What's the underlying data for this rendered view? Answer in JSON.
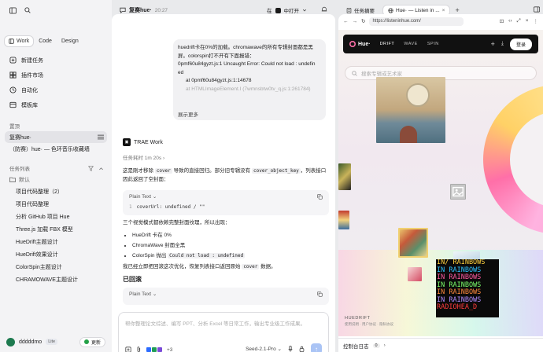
{
  "sidebar": {
    "segments": [
      {
        "label": "Work",
        "active": true
      },
      {
        "label": "Code",
        "active": false
      },
      {
        "label": "Design",
        "active": false
      }
    ],
    "menu": [
      {
        "label": "新建任务",
        "icon": "plus-icon"
      },
      {
        "label": "插件市场",
        "icon": "store-icon"
      },
      {
        "label": "自动化",
        "icon": "clock-icon"
      },
      {
        "label": "模板库",
        "icon": "template-icon"
      }
    ],
    "pinned_header": "置顶",
    "pinned": [
      {
        "label": "复赛hue·",
        "selected": true
      },
      {
        "label": "（防赛）hue· — 色环音乐收藏墙",
        "selected": false
      }
    ],
    "tasks_header": "任务列表",
    "group_label": "默认",
    "tasks": [
      "项目代码整理（2）",
      "项目代码整理",
      "分析 GitHub 项目 Hue",
      "Three.js 加载 FBX 模型",
      "HueDrift主题设计",
      "HueDrift效果设计",
      "ColorSpin主题设计",
      "CHRAMOWAVE主题设计"
    ],
    "user": {
      "name": "dddddmo",
      "plan": "Lite",
      "update_label": "更新"
    }
  },
  "chat": {
    "title": "复赛hue·",
    "time": "20:27",
    "env_label": "在",
    "env_value": "中打开",
    "user_message": [
      "huedrift卡在0%的加载。chromawave的所有专辑封面都是黑",
      "屏。colorspin打不开有下面报错：",
      "0pmf60u84gyzt.js:1 Uncaught Error: Could not load : undefin",
      "ed",
      "    at 0pmf60u84gyzt.js:1:14678",
      "    at HTMLImageElement.I (7wmnsbtw0tv_q.js:1:261784)"
    ],
    "expand_label": "展示更多",
    "agent_name": "TRAE Work",
    "elapsed": "任务耗时 1m 20s",
    "reply_intro": {
      "a": "这是刚才移除 ",
      "code1": "cover",
      "b": " 导致的直接回归。部分旧专辑没有 ",
      "code2": "cover_object_key",
      "c": "，列表接口",
      "d": "因此返回了空封面："
    },
    "code_block": {
      "lang": "Plain Text",
      "line_no": "1",
      "code": "coverUrl: undefined / \"\""
    },
    "reply_mid": "三个视觉模式都依赖完整封面纹理，所以出现：",
    "bullets": [
      {
        "text": "HueDrift 卡在 0%",
        "code": ""
      },
      {
        "text": "ChromaWave 封面全黑",
        "code": ""
      },
      {
        "text": "ColorSpin 抛出 ",
        "code": "Could not load : undefined"
      }
    ],
    "reply_fix": {
      "a": "我已经立即把回滚这次优化，恢复列表接口返回原始 ",
      "code": "cover",
      "b": " 数据。"
    },
    "restored_heading": "已回滚",
    "code_block2": {
      "lang": "Plain Text"
    },
    "composer": {
      "placeholder": "帮你整理论文综述、编写 PPT、分析 Excel 等日常工作，输出专业级工作成果。",
      "extra_count": "+3",
      "model": "Seed-2.1-Pro"
    }
  },
  "browser": {
    "tabs": [
      {
        "label": "任务摘要",
        "active": false
      },
      {
        "label": "Hue· — Listen in ...",
        "active": true
      }
    ],
    "url": "https://listeninhue.com/",
    "site": {
      "logo": "Hue·",
      "nav": [
        "DRIFT",
        "WAVE",
        "SPIN"
      ],
      "login": "登录",
      "search_placeholder": "搜索专辑或艺术家",
      "footer_brand": "HUEDRIFT",
      "footer_links": "使用说明 · 用户协议 · 隐私协议",
      "album_lines": [
        "IN/ RAINBOWS",
        "IN RAINBOWS",
        "IN RAINBOWS",
        "IN RAINBOWS",
        "IN RAINBOWS",
        "IN RAINBOWS",
        "RADIOHEA_D"
      ]
    },
    "devlog_label": "控制台日志",
    "devlog_count": "0"
  }
}
